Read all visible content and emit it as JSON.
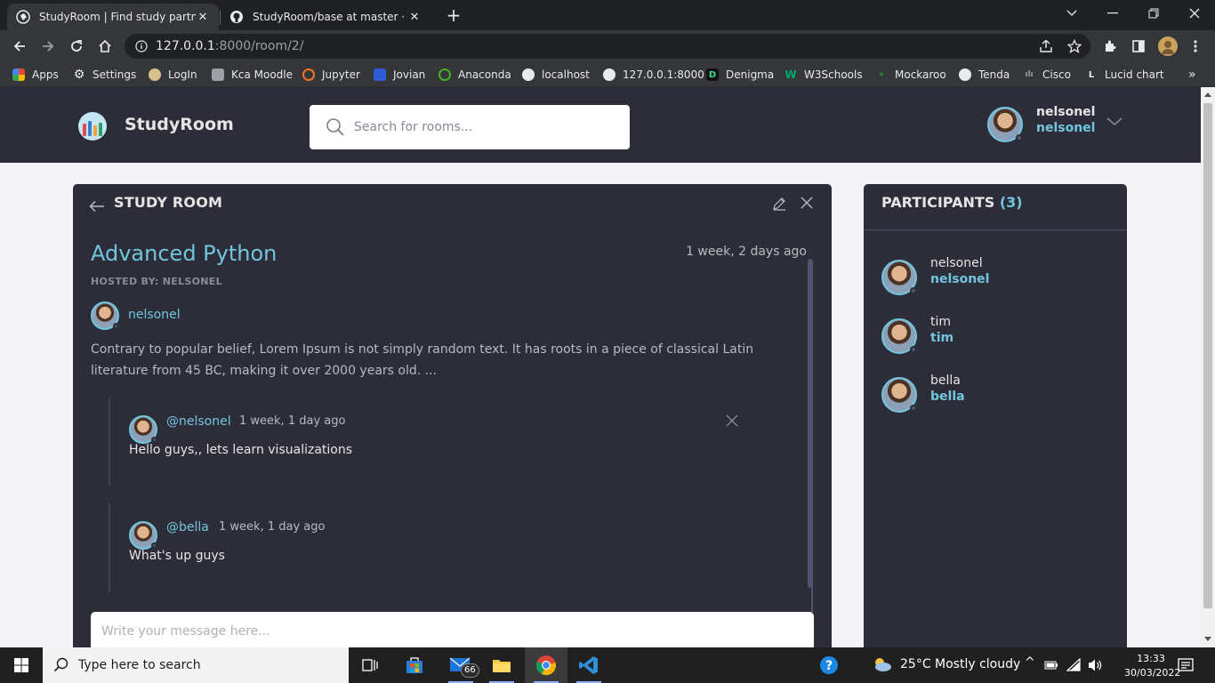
{
  "browser": {
    "tabs": [
      {
        "title": "StudyRoom | Find study partners",
        "active": true
      },
      {
        "title": "StudyRoom/base at master · 1Ne",
        "active": false
      }
    ],
    "address": {
      "host": "127.0.0.1",
      "path": ":8000/room/2/"
    },
    "bookmarks": [
      {
        "label": "Apps",
        "icon": "apps-grid-icon"
      },
      {
        "label": "Settings",
        "icon": "gear-icon"
      },
      {
        "label": "LogIn",
        "icon": "login-icon"
      },
      {
        "label": "Kca Moodle",
        "icon": "moodle-icon"
      },
      {
        "label": "Jupyter",
        "icon": "jupyter-icon"
      },
      {
        "label": "Jovian",
        "icon": "jovian-icon"
      },
      {
        "label": "Anaconda",
        "icon": "anaconda-icon"
      },
      {
        "label": "localhost",
        "icon": "globe-icon"
      },
      {
        "label": "127.0.0.1:8000",
        "icon": "globe-icon"
      },
      {
        "label": "Denigma",
        "icon": "denigma-icon"
      },
      {
        "label": "W3Schools",
        "icon": "w3schools-icon"
      },
      {
        "label": "Mockaroo",
        "icon": "mockaroo-icon"
      },
      {
        "label": "Tenda",
        "icon": "globe-icon"
      },
      {
        "label": "Cisco",
        "icon": "cisco-icon"
      },
      {
        "label": "Lucid chart",
        "icon": "lucid-icon"
      }
    ]
  },
  "header": {
    "brand": "StudyRoom",
    "search_placeholder": "Search for rooms...",
    "user": {
      "name": "nelsonel",
      "handle": "nelsonel"
    }
  },
  "room": {
    "heading": "STUDY ROOM",
    "name": "Advanced Python",
    "created": "1 week, 2 days ago",
    "hosted_by": "HOSTED BY: NELSONEL",
    "host": "nelsonel",
    "description": "Contrary to popular belief, Lorem Ipsum is not simply random text. It has roots in a piece of classical Latin literature from 45 BC, making it over 2000 years old. ...",
    "messages": [
      {
        "user": "@nelsonel",
        "time": "1 week, 1 day ago",
        "body": "Hello guys,, lets learn visualizations",
        "deletable": true
      },
      {
        "user": "@bella",
        "time": "1 week, 1 day ago",
        "body": "What's up guys",
        "deletable": false
      }
    ],
    "composer_placeholder": "Write your message here..."
  },
  "participants": {
    "title": "PARTICIPANTS",
    "count": "(3)",
    "list": [
      {
        "name": "nelsonel",
        "handle": "nelsonel"
      },
      {
        "name": "tim",
        "handle": "tim"
      },
      {
        "name": "bella",
        "handle": "bella"
      }
    ]
  },
  "taskbar": {
    "search_placeholder": "Type here to search",
    "mail_badge": "66",
    "weather": "25°C  Mostly cloudy",
    "time": "13:33",
    "date": "30/03/2022"
  },
  "colors": {
    "accent": "#71c6dd",
    "panel": "#2d2d39",
    "page": "#f4f4f6"
  }
}
